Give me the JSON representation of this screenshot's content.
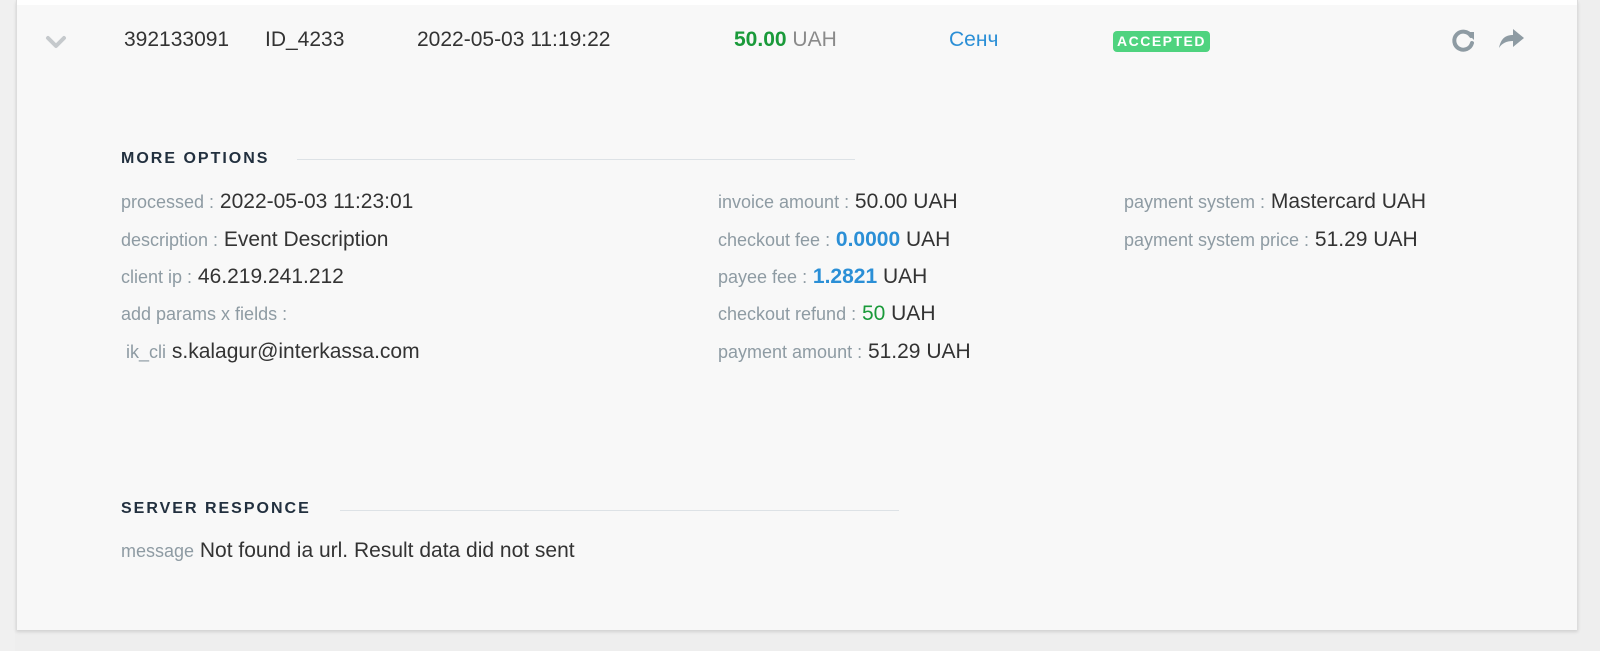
{
  "transaction": {
    "number": "392133091",
    "id": "ID_4233",
    "datetime": "2022-05-03 11:19:22",
    "amount_value": "50.00",
    "amount_currency": "UAH",
    "name": "Сенч",
    "status": "ACCEPTED"
  },
  "more_options": {
    "title": "MORE OPTIONS",
    "col1": [
      {
        "label": "processed :",
        "value": "2022-05-03 11:23:01"
      },
      {
        "label": "description :",
        "value": "Event Description"
      },
      {
        "label": "client ip :",
        "value": "46.219.241.212"
      },
      {
        "label": "add params x fields :",
        "value": ""
      },
      {
        "label": "ik_cli",
        "value": "s.kalagur@interkassa.com"
      }
    ],
    "col2": {
      "invoice_amount": {
        "label": "invoice amount :",
        "value": "50.00 UAH"
      },
      "checkout_fee": {
        "label": "checkout fee :",
        "number": "0.0000",
        "currency": "UAH"
      },
      "payee_fee": {
        "label": "payee fee :",
        "number": "1.2821",
        "currency": "UAH"
      },
      "checkout_refund": {
        "label": "checkout refund :",
        "number": "50",
        "currency": "UAH"
      },
      "payment_amount": {
        "label": "payment amount :",
        "value": "51.29 UAH"
      }
    },
    "col3": [
      {
        "label": "payment system :",
        "value": "Mastercard UAH"
      },
      {
        "label": "payment system price :",
        "value": "51.29 UAH"
      }
    ]
  },
  "server_response": {
    "title": "SERVER RESPONCE",
    "label": "message",
    "value": "Not found ia url. Result data did not sent"
  },
  "colors": {
    "amount_green": "#1a9a3a",
    "link_blue": "#2b8fd6",
    "badge_green": "#4fd37f"
  },
  "icons": [
    "chevron-down-icon",
    "refresh-icon",
    "send-arrow-icon"
  ]
}
